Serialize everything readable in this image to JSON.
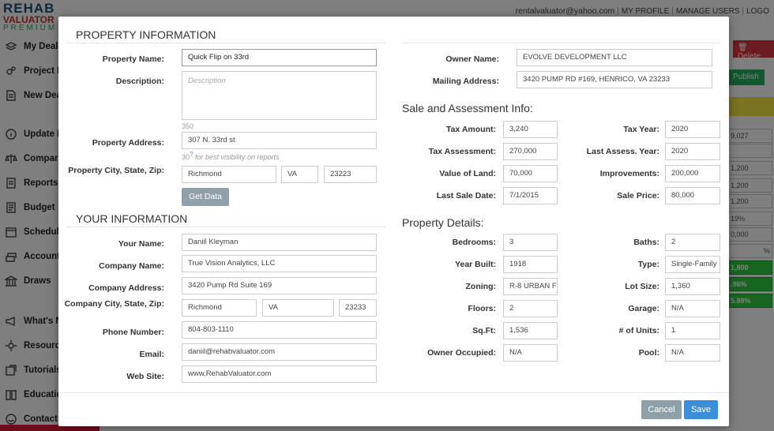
{
  "background": {
    "logo": {
      "line1": "REHAB",
      "line2": "VALUATOR",
      "line3": "PREMIUM"
    },
    "topnav": {
      "email": "rentalvaluator@yahoo.com",
      "profile": "MY PROFILE",
      "manage": "MANAGE USERS",
      "logout": "LOGO"
    },
    "sidebar": [
      {
        "label": "My Deals",
        "icon": "layers-icon"
      },
      {
        "label": "Project M",
        "icon": "gears-icon"
      },
      {
        "label": "New Deal",
        "icon": "document-icon"
      },
      {
        "label": "Update In",
        "icon": "info-icon"
      },
      {
        "label": "Compara",
        "icon": "scales-icon"
      },
      {
        "label": "Reports",
        "icon": "report-icon"
      },
      {
        "label": "Budget",
        "icon": "budget-icon"
      },
      {
        "label": "Schedule",
        "icon": "calendar-icon"
      },
      {
        "label": "Accounti",
        "icon": "accounting-icon"
      },
      {
        "label": "Draws",
        "icon": "bank-icon"
      },
      {
        "label": "What's Ne",
        "icon": "megaphone-icon"
      },
      {
        "label": "Resource",
        "icon": "gear-icon"
      },
      {
        "label": "Tutorials",
        "icon": "tutorial-icon"
      },
      {
        "label": "Educatio",
        "icon": "book-icon"
      },
      {
        "label": "Contact",
        "icon": "contact-icon"
      }
    ],
    "right_buttons": {
      "delete": "Delete",
      "publish": "Publish"
    },
    "right_cells": [
      "9,027",
      "",
      "1,200",
      "1,200",
      "1,200",
      "19%",
      "0,000",
      "%",
      "1,800",
      ".96%",
      "5.88%"
    ]
  },
  "modal": {
    "property_section": {
      "title": "PROPERTY INFORMATION",
      "name_label": "Property Name:",
      "name_value": "Quick Flip on 33rd",
      "description_label": "Description:",
      "description_placeholder": "Description",
      "description_counter": "350",
      "address_label": "Property Address:",
      "address_value": "307 N. 33rd st",
      "address_counter": "30",
      "address_hint_q": "?",
      "address_hint": "for best visibility on reports",
      "city_label": "Property City, State, Zip:",
      "city": "Richmond",
      "state": "VA",
      "zip": "23223",
      "get_data_button": "Get Data"
    },
    "your_section": {
      "title": "YOUR INFORMATION",
      "name_label": "Your Name:",
      "name_value": "Daniil Kleyman",
      "company_label": "Company Name:",
      "company_value": "True Vision Analytics, LLC",
      "company_address_label": "Company Address:",
      "company_address_value": "3420 Pump Rd Suite 169",
      "company_city_label": "Company City, State, Zip:",
      "company_city": "Richmond",
      "company_state": "VA",
      "company_zip": "23233",
      "phone_label": "Phone Number:",
      "phone_value": "804-803-1110",
      "email_label": "Email:",
      "email_value": "daniil@rehabvaluator.com",
      "website_label": "Web Site:",
      "website_value": "www.RehabValuator.com"
    },
    "owner_section": {
      "owner_label": "Owner Name:",
      "owner_value": "EVOLVE DEVELOPMENT LLC",
      "mailing_label": "Mailing Address:",
      "mailing_value": "3420 PUMP RD #169, HENRICO, VA 23233"
    },
    "assessment_section": {
      "title": "Sale and Assessment Info:",
      "tax_amount_label": "Tax Amount:",
      "tax_amount": "3,240",
      "tax_year_label": "Tax Year:",
      "tax_year": "2020",
      "tax_assessment_label": "Tax Assessment:",
      "tax_assessment": "270,000",
      "last_assess_year_label": "Last Assess. Year:",
      "last_assess_year": "2020",
      "land_label": "Value of Land:",
      "land": "70,000",
      "improvements_label": "Improvements:",
      "improvements": "200,000",
      "last_sale_label": "Last Sale Date:",
      "last_sale": "7/1/2015",
      "sale_price_label": "Sale Price:",
      "sale_price": "80,000"
    },
    "details_section": {
      "title": "Property Details:",
      "bedrooms_label": "Bedrooms:",
      "bedrooms": "3",
      "baths_label": "Baths:",
      "baths": "2",
      "year_built_label": "Year Built:",
      "year_built": "1918",
      "type_label": "Type:",
      "type": "Single-Family",
      "zoning_label": "Zoning:",
      "zoning": "R-8 URBAN F",
      "lot_size_label": "Lot Size:",
      "lot_size": "1,360",
      "floors_label": "Floors:",
      "floors": "2",
      "garage_label": "Garage:",
      "garage": "N/A",
      "sqft_label": "Sq.Ft:",
      "sqft": "1,536",
      "units_label": "# of Units:",
      "units": "1",
      "owner_occupied_label": "Owner Occupied:",
      "owner_occupied": "N/A",
      "pool_label": "Pool:",
      "pool": "N/A"
    },
    "footer": {
      "cancel": "Cancel",
      "save": "Save"
    }
  }
}
